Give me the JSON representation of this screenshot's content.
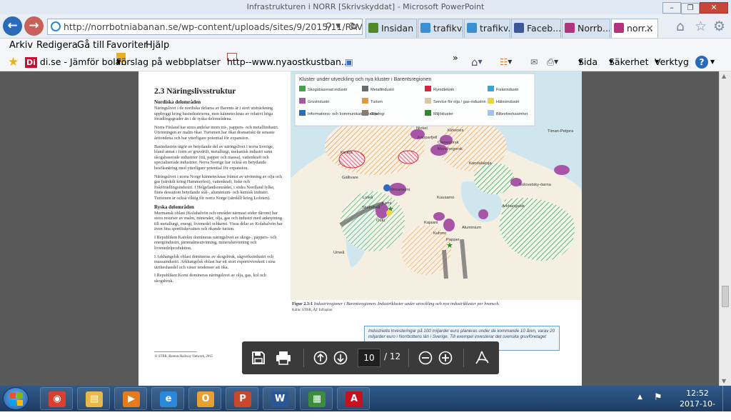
{
  "window_title": "Infrastrukturen i NORR [Skrivskyddat] - Microsoft PowerPoint",
  "browser": {
    "address": "http://norrbotniabanan.se/wp-content/uploads/sites/9/2015/11/RAVAR",
    "tabs": [
      {
        "label": "Insidan",
        "color": "#4e8a2a"
      },
      {
        "label": "trafikv...",
        "color": "#3a8fd1"
      },
      {
        "label": "trafikv...",
        "color": "#3a8fd1"
      },
      {
        "label": "Faceb...",
        "color": "#3b5998"
      },
      {
        "label": "Norrb...",
        "color": "#b0357c"
      },
      {
        "label": "norr...",
        "color": "#b0357c"
      }
    ],
    "close_glyph": "×"
  },
  "menu": [
    "Arkiv",
    "Redigera",
    "Gå till",
    "Favoriter",
    "Hjälp"
  ],
  "favorites": {
    "items": [
      "di.se - Jämför bolån",
      "Förslag på webbplatser",
      "http--www.nyaostkustban..."
    ],
    "di_badge": "Di",
    "overflow": "»",
    "commands": [
      "Sida",
      "Säkerhet",
      "Verktyg"
    ]
  },
  "document": {
    "heading": "2.3  Näringslivsstruktur",
    "sub1": "Nordiska delområden",
    "paragraphs_left": [
      "Näringslivet i de nordiska delarna av Barents är i stort utsträckning uppbyggt kring basindustrierna, men kännetecknas av relativt höga förädlingsgrader än i de ryska delområdena.",
      "Norra Finland har stora andelar inom trä-, pappers- och metallindustri. Utvinningen av malm ökar. Turismen har ökat dramatiskt de senaste årtiondena och har ytterligare potential för expansion.",
      "Basindustrin utgör en betydande del av näringslivet i norra Sverige, bland annat i form av gruvdrift, metallurgi, mekanisk industri samt skogsbaserade industrier (trä, papper och massa), vattenkraft och specialiserade industrier. Norra Sverige har också en betydande besöksnäring med ytterligare potential för expansion.",
      "Näringslivet i norra Norge kännetecknas främst av utvinning av olja och gas (särskilt kring Hammerfest), vattenkraft, fiske och fiskförädlingsindustri. I Helgelandsområdet, i södra Nordland fylke, finns dessutom betydande stål-, aluminium- och kemisk industri. Turismen är också viktig för norra Norge (särskilt kring Lofoten)."
    ],
    "sub2": "Ryska delområden",
    "paragraphs_right": [
      "Murmansk oblast (Kolahalvön och området närmast söder därom) har stora resurser av malm, mineraler, olja, gas och industri med anknytning till metallurgi, energi, livsmedel ochkemi. Vissa delar av Kolahalvön har även fina sportfiskevatten och ökande turism.",
      "I Republiken Karelen domineras näringslivet av skogs-, pappers- och energiindustri, järnmalmsutvinning, mineralutvinning och livsmedelproduktion.",
      "I Arkhangelsk oblast domineras av skogsbruk, sågverksindustri och massaindustri. Arkhangelsk oblast har ett stort exportöverskott i sina utrikeshandel och växer tendenser att öka.",
      "I Republiken Komi domineras näringslivet av olja, gas, kol och skogsbruk."
    ],
    "footnote": "11  STBR. Barents Railway Network, 2015",
    "legend_title": "Kluster under utveckling och nya kluster i Barentsregionen",
    "legend": [
      {
        "label": "Skogsbaserad industri",
        "color": "#3fa34d"
      },
      {
        "label": "Metallindustri",
        "color": "#6b6b6b"
      },
      {
        "label": "Rymdteknik",
        "color": "#d8243a"
      },
      {
        "label": "Fiskeindustri",
        "color": "#3ba3d6"
      },
      {
        "label": "Gruvindustri",
        "color": "#a855a8"
      },
      {
        "label": "Turism",
        "color": "#e8963a"
      },
      {
        "label": "Service för olja / gas-industrin",
        "color": "#d9c7a0"
      },
      {
        "label": "Hälsoindustri",
        "color": "#f2d23c"
      },
      {
        "label": "Informations- och kommunikationsteknologi",
        "color": "#2a6cc2"
      },
      {
        "label": "Olja",
        "color": "#8a7a6a"
      },
      {
        "label": "Miljökluster",
        "color": "#2d8a2d"
      },
      {
        "label": "Biltestverksamhet",
        "color": "#9fc4e8"
      }
    ],
    "map_labels": [
      "Timan-Petjora",
      "Kirkenes",
      "Nickel",
      "Kopparfjell",
      "Olenegorsk",
      "Monchegorsk",
      "Kiruna",
      "Gällivare",
      "Rovaniemi",
      "Luleå",
      "Skellefteå",
      "Umeå",
      "Oulu",
      "Kemi",
      "Kajaani",
      "Kuhmo",
      "Kuusamo",
      "Arkhangelsk",
      "Solovetsky-öarna",
      "Papper",
      "Aluminium",
      "Kandalaksja"
    ],
    "caption_lead": "Figur 2.3:1",
    "caption": "Industriregioner i Barentsregionen. Industrikluster under utveckling och nya industrikluster per bransch.",
    "caption_source": "Källa: STBR, ÅF Infraplan",
    "infobox": "Industriella investeringar på 100 miljarder euro planeras under de kommande 10 åren, varav 20 miljarder euro i Norrbottens län i Sverige. Till exempel investerar det svenska gruvföretaget"
  },
  "pdf_toolbar": {
    "page_value": "10",
    "page_total": "/ 12"
  },
  "taskbar": {
    "time": "12:52",
    "date": "2017-10-29",
    "apps": [
      {
        "name": "chrome",
        "color": "#d8412f"
      },
      {
        "name": "explorer",
        "color": "#e7b94a"
      },
      {
        "name": "media-player",
        "color": "#e37b1f"
      },
      {
        "name": "internet-explorer",
        "color": "#2a88d8"
      },
      {
        "name": "outlook",
        "color": "#e9a033"
      },
      {
        "name": "powerpoint",
        "color": "#c9472b"
      },
      {
        "name": "word",
        "color": "#2b5797"
      },
      {
        "name": "task-manager",
        "color": "#3c8c3c"
      },
      {
        "name": "acrobat",
        "color": "#c7101e"
      }
    ]
  }
}
